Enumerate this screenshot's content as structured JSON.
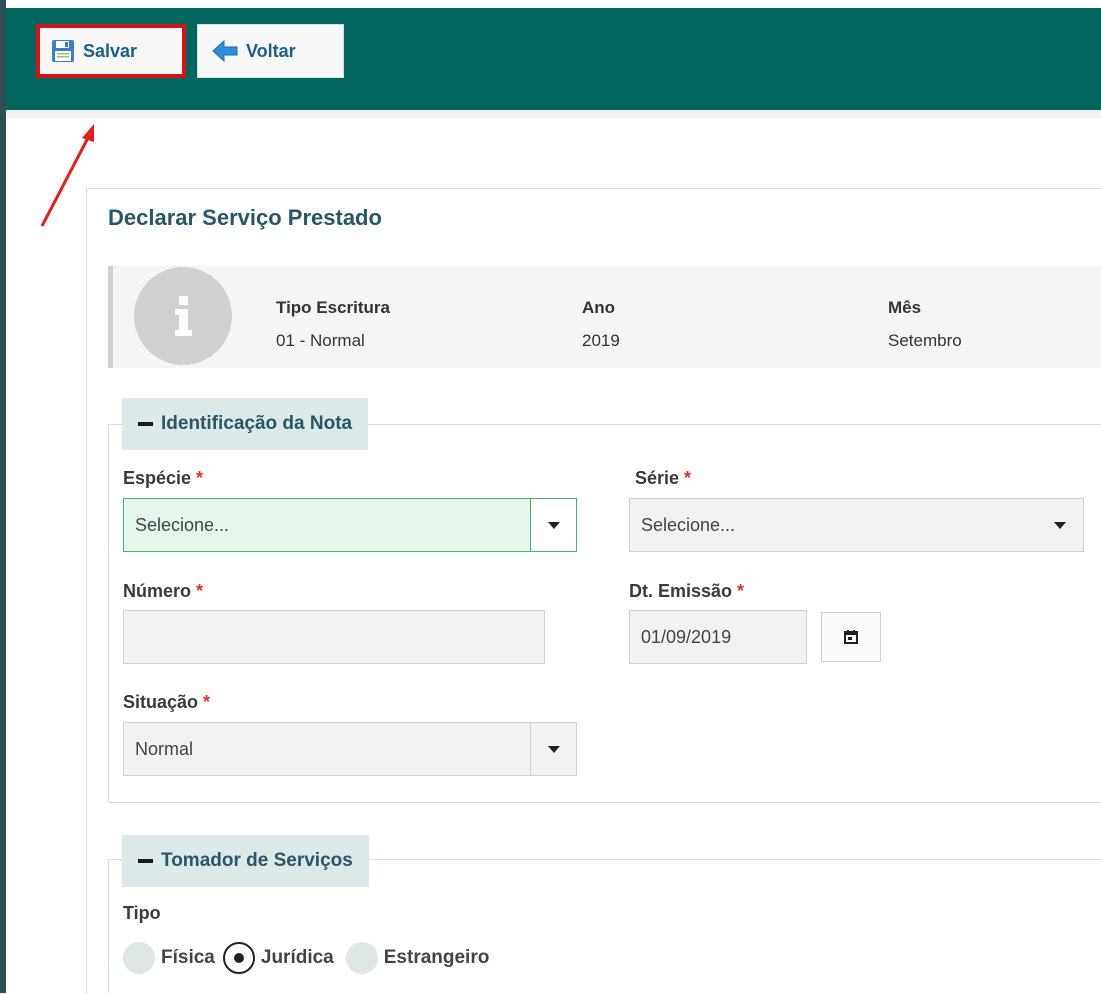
{
  "toolbar": {
    "save_label": "Salvar",
    "back_label": "Voltar"
  },
  "page": {
    "title": "Declarar Serviço Prestado"
  },
  "info": {
    "tipo_escritura_label": "Tipo Escritura",
    "tipo_escritura_value": "01 - Normal",
    "ano_label": "Ano",
    "ano_value": "2019",
    "mes_label": "Mês",
    "mes_value": "Setembro"
  },
  "identificacao": {
    "legend": "Identificação da Nota",
    "especie_label": "Espécie",
    "especie_value": "Selecione...",
    "serie_label": "Série",
    "serie_value": "Selecione...",
    "numero_label": "Número",
    "numero_value": "",
    "dt_emissao_label": "Dt. Emissão",
    "dt_emissao_value": "01/09/2019",
    "situacao_label": "Situação",
    "situacao_value": "Normal",
    "required_mark": "*"
  },
  "tomador": {
    "legend": "Tomador de Serviços",
    "tipo_label": "Tipo",
    "options": [
      "Física",
      "Jurídica",
      "Estrangeiro"
    ],
    "selected": "Jurídica"
  },
  "colors": {
    "topbar": "#00665e",
    "highlight": "#d3141b",
    "accent_text": "#2a5766"
  }
}
